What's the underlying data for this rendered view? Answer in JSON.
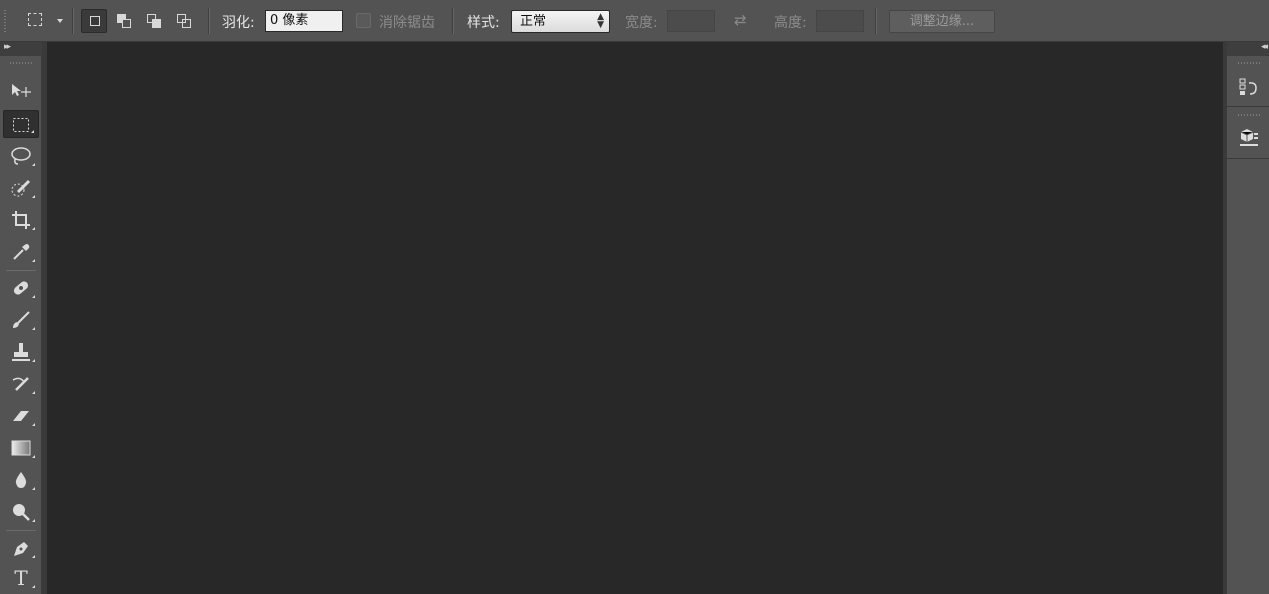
{
  "options_bar": {
    "feather_label": "羽化:",
    "feather_value": "0 像素",
    "antialias_label": "消除锯齿",
    "style_label": "样式:",
    "style_value": "正常",
    "width_label": "宽度:",
    "height_label": "高度:",
    "refine_edge_label": "调整边缘..."
  },
  "toolbar": {
    "tools": [
      {
        "name": "move-tool",
        "icon": "move-icon"
      },
      {
        "name": "rectangular-marquee-tool",
        "icon": "marquee-icon",
        "active": true
      },
      {
        "name": "lasso-tool",
        "icon": "lasso-icon"
      },
      {
        "name": "quick-selection-tool",
        "icon": "quick-selection-icon"
      },
      {
        "name": "crop-tool",
        "icon": "crop-icon"
      },
      {
        "name": "eyedropper-tool",
        "icon": "eyedropper-icon"
      },
      {
        "name": "spot-healing-tool",
        "icon": "bandage-icon"
      },
      {
        "name": "brush-tool",
        "icon": "brush-icon"
      },
      {
        "name": "clone-stamp-tool",
        "icon": "stamp-icon"
      },
      {
        "name": "history-brush-tool",
        "icon": "history-brush-icon"
      },
      {
        "name": "eraser-tool",
        "icon": "eraser-icon"
      },
      {
        "name": "gradient-tool",
        "icon": "gradient-icon"
      },
      {
        "name": "blur-tool",
        "icon": "drop-icon"
      },
      {
        "name": "dodge-tool",
        "icon": "dodge-icon"
      },
      {
        "name": "pen-tool",
        "icon": "pen-icon"
      },
      {
        "name": "type-tool",
        "icon": "type-icon",
        "glyph": "T"
      }
    ]
  },
  "dock": {
    "panels": [
      {
        "name": "history-panel-button",
        "icon": "history-icon"
      },
      {
        "name": "3d-panel-button",
        "icon": "cube-icon"
      }
    ]
  },
  "colors": {
    "panel_bg": "#535353",
    "canvas_bg": "#282828",
    "input_bg": "#f0f0f0"
  }
}
